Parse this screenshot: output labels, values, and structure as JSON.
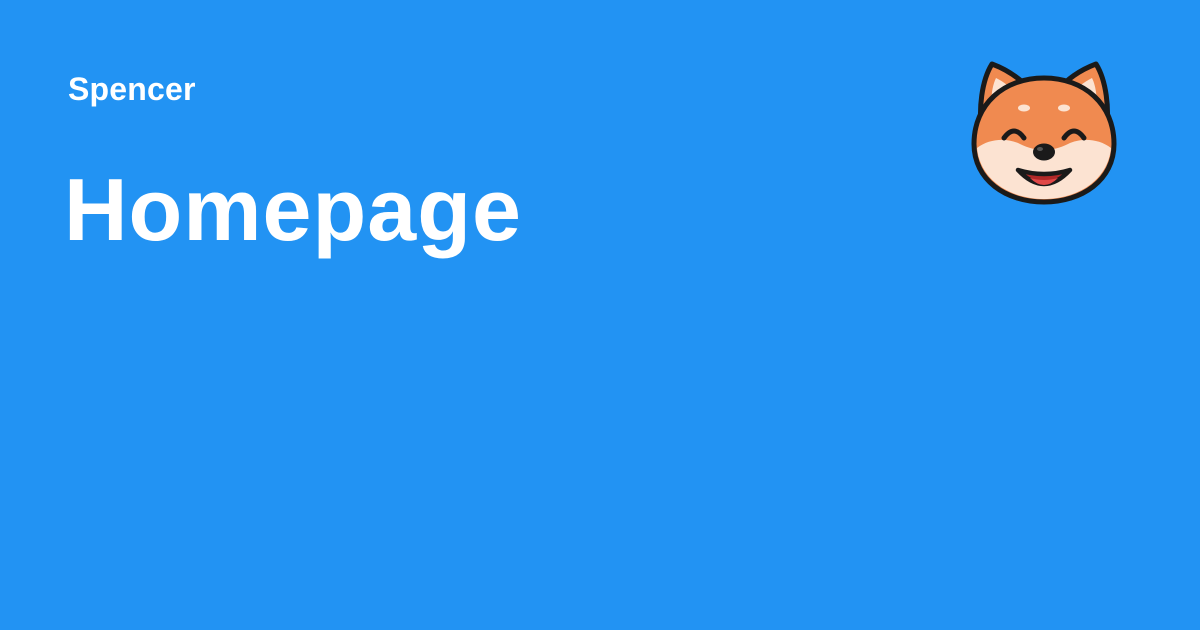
{
  "card": {
    "site_name": "Spencer",
    "page_title": "Homepage"
  },
  "mascot": {
    "icon": "shiba-inu-dog-face-icon"
  },
  "colors": {
    "background": "#2293F3",
    "text": "#FFFFFF",
    "fur": "#F08A50",
    "fur_light": "#FCE3D2",
    "outline": "#1A1A1A",
    "tongue": "#E04848"
  }
}
